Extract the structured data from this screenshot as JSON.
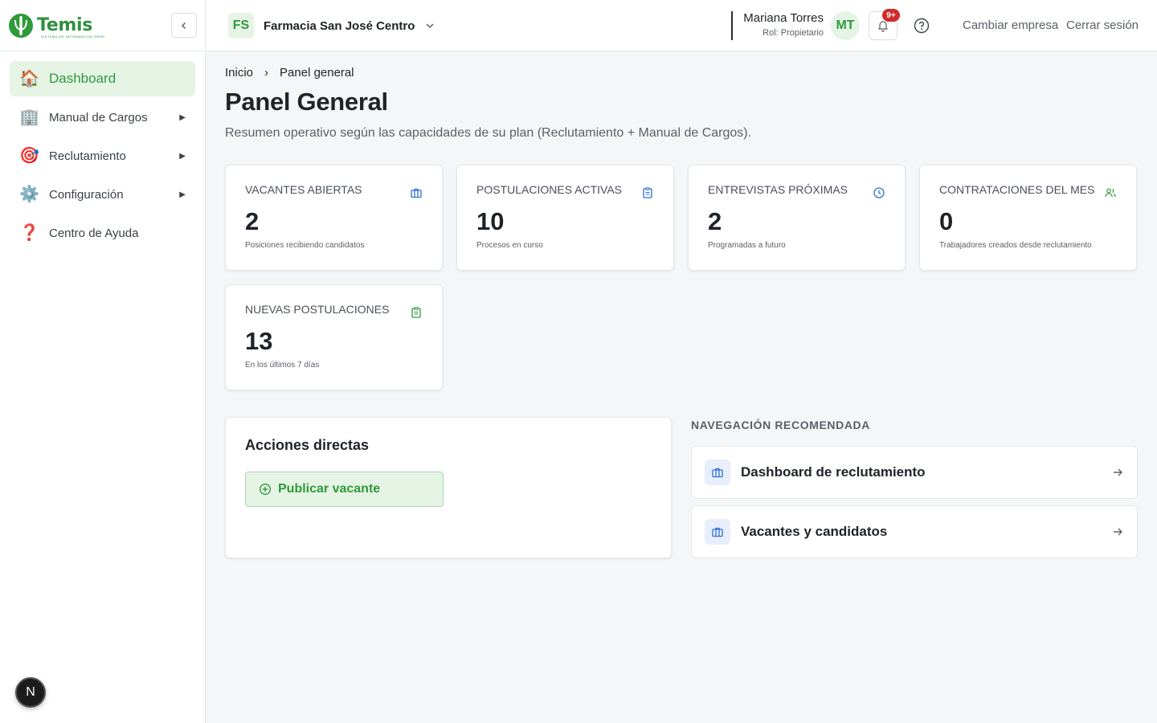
{
  "brand": {
    "name": "Temis",
    "tagline": "SISTEMA DE INFORMACION RRHH"
  },
  "sidebar": {
    "items": [
      {
        "label": "Dashboard",
        "icon": "🏠",
        "active": true,
        "arrow": ""
      },
      {
        "label": "Manual de Cargos",
        "icon": "🏢",
        "active": false,
        "arrow": "▶"
      },
      {
        "label": "Reclutamiento",
        "icon": "🎯",
        "active": false,
        "arrow": "▶"
      },
      {
        "label": "Configuración",
        "icon": "⚙️",
        "active": false,
        "arrow": "▶"
      },
      {
        "label": "Centro de Ayuda",
        "icon": "❓",
        "active": false,
        "arrow": ""
      }
    ],
    "dev_badge": "N"
  },
  "topbar": {
    "company_initials": "FS",
    "company_name": "Farmacia San José Centro",
    "user_name": "Mariana Torres",
    "user_role": "Rol: Propietario",
    "user_initials": "MT",
    "notifications_badge": "9+",
    "switch_company": "Cambiar empresa",
    "logout": "Cerrar sesión"
  },
  "breadcrumb": {
    "home": "Inicio",
    "separator": "›",
    "current": "Panel general"
  },
  "page": {
    "title": "Panel General",
    "subtitle": "Resumen operativo según las capacidades de su plan (Reclutamiento + Manual de Cargos)."
  },
  "stats": [
    {
      "label": "VACANTES ABIERTAS",
      "value": "2",
      "desc": "Posiciones recibiendo candidatos",
      "icon": "briefcase-icon",
      "color": "#2f6fd6"
    },
    {
      "label": "POSTULACIONES ACTIVAS",
      "value": "10",
      "desc": "Procesos en curso",
      "icon": "clipboard-icon",
      "color": "#2f6fd6"
    },
    {
      "label": "ENTREVISTAS PRÓXIMAS",
      "value": "2",
      "desc": "Programadas a futuro",
      "icon": "clock-icon",
      "color": "#2f6fd6"
    },
    {
      "label": "CONTRATACIONES DEL MES",
      "value": "0",
      "desc": "Trabajadores creados desde reclutamiento",
      "icon": "users-icon",
      "color": "#2f9a3a"
    },
    {
      "label": "NUEVAS POSTULACIONES",
      "value": "13",
      "desc": "En los últimos 7 días",
      "icon": "clipboard-check-icon",
      "color": "#2f9a3a"
    }
  ],
  "actions": {
    "title": "Acciones directas",
    "publish_label": "Publicar vacante"
  },
  "recommended": {
    "title": "NAVEGACIÓN RECOMENDADA",
    "items": [
      {
        "label": "Dashboard de reclutamiento"
      },
      {
        "label": "Vacantes y candidatos"
      }
    ]
  },
  "colors": {
    "accent_green": "#2f9a3a",
    "accent_blue": "#2f6fd6",
    "badge_red": "#d12b2b"
  }
}
